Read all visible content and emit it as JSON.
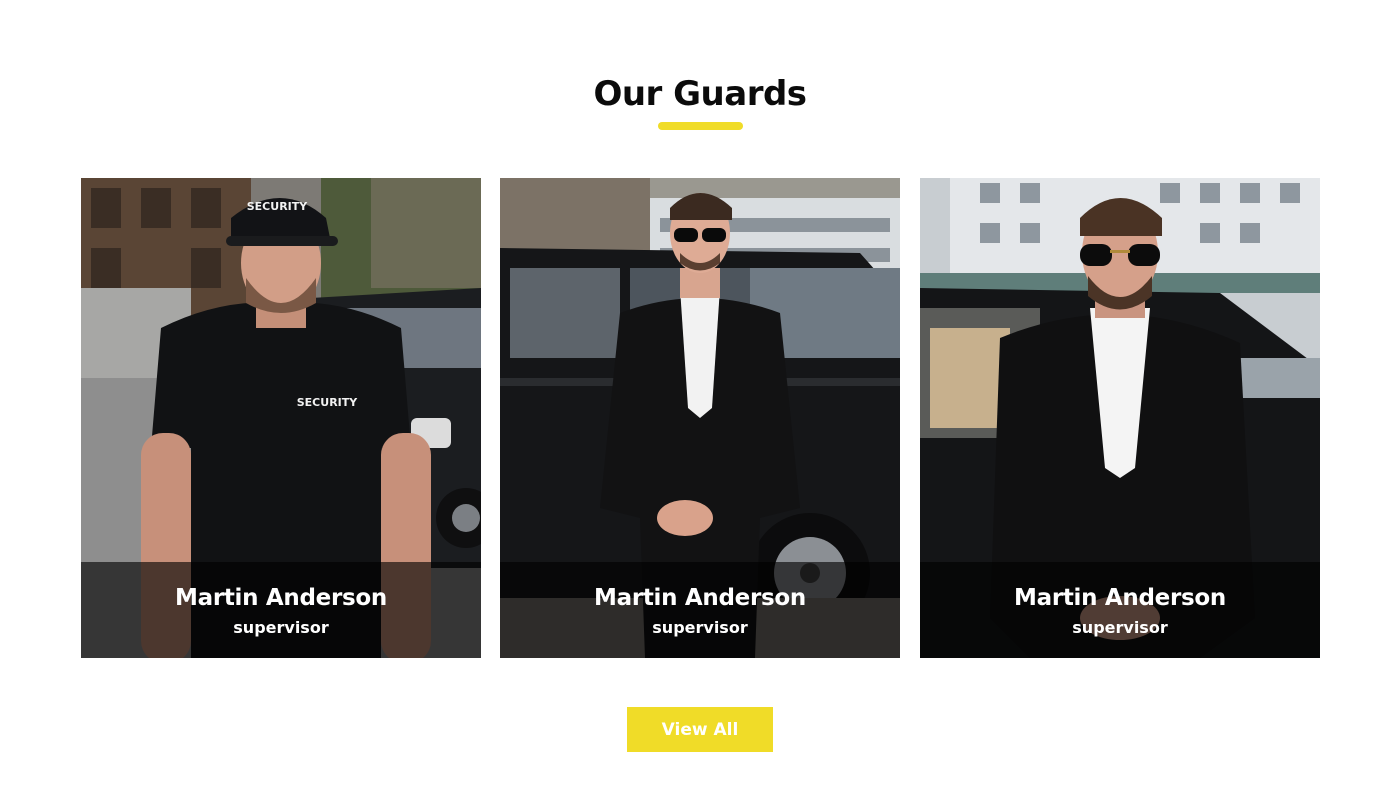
{
  "section": {
    "title": "Our Guards"
  },
  "guards": [
    {
      "name": "Martin Anderson",
      "role": "supervisor",
      "photo": "guard-in-security-polo-and-cap-photo",
      "shirt_text": "SECURITY",
      "cap_text": "SECURITY"
    },
    {
      "name": "Martin Anderson",
      "role": "supervisor",
      "photo": "guard-in-suit-with-sunglasses-photo"
    },
    {
      "name": "Martin Anderson",
      "role": "supervisor",
      "photo": "guard-in-suit-beside-car-photo"
    }
  ],
  "actions": {
    "view_all_label": "View All"
  },
  "colors": {
    "accent": "#f0dc28",
    "title": "#0b0b0b",
    "overlay": "rgba(0,0,0,0.62)"
  }
}
